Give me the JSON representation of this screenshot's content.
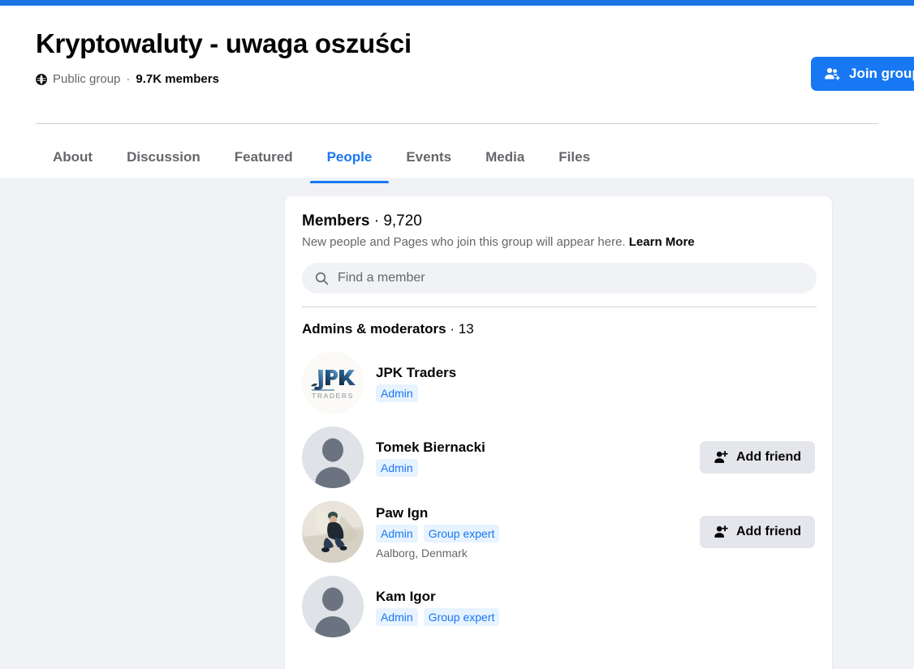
{
  "browser": {
    "top_bar_color": "#1b74e4"
  },
  "group": {
    "title": "Kryptowaluty - uwaga oszuści",
    "privacy": "Public group",
    "meta_separator": "·",
    "member_count_label": "9.7K members",
    "privacy_icon": "globe-icon",
    "join_button": {
      "label": "Join group",
      "icon": "people-add-icon",
      "color": "#1877f2"
    }
  },
  "tabs": [
    {
      "label": "About",
      "active": false
    },
    {
      "label": "Discussion",
      "active": false
    },
    {
      "label": "Featured",
      "active": false
    },
    {
      "label": "People",
      "active": true
    },
    {
      "label": "Events",
      "active": false
    },
    {
      "label": "Media",
      "active": false
    },
    {
      "label": "Files",
      "active": false
    }
  ],
  "members_card": {
    "heading": "Members",
    "heading_separator": "·",
    "heading_count": "9,720",
    "description": "New people and Pages who join this group will appear here.",
    "learn_more_label": "Learn More",
    "search": {
      "placeholder": "Find a member",
      "icon": "search-icon",
      "value": ""
    },
    "section": {
      "title": "Admins & moderators",
      "separator": "·",
      "count": "13"
    },
    "members": [
      {
        "name": "JPK Traders",
        "badges": [
          "Admin"
        ],
        "location": "",
        "avatar_type": "logo-jpk-traders",
        "action": null
      },
      {
        "name": "Tomek Biernacki",
        "badges": [
          "Admin"
        ],
        "location": "",
        "avatar_type": "default-silhouette",
        "action": {
          "label": "Add friend",
          "icon": "person-add-icon"
        }
      },
      {
        "name": "Paw Ign",
        "badges": [
          "Admin",
          "Group expert"
        ],
        "location": "Aalborg, Denmark",
        "avatar_type": "photo-person-on-rocks",
        "action": {
          "label": "Add friend",
          "icon": "person-add-icon"
        }
      },
      {
        "name": "Kam Igor",
        "badges": [
          "Admin",
          "Group expert"
        ],
        "location": "",
        "avatar_type": "default-silhouette",
        "action": null
      }
    ]
  },
  "colors": {
    "page_background": "#f0f2f5",
    "card_background": "#ffffff",
    "accent_blue": "#1877f2",
    "badge_background": "#e7f3ff",
    "button_gray": "#e4e6eb",
    "text_primary": "#050505",
    "text_secondary": "#65676b"
  }
}
